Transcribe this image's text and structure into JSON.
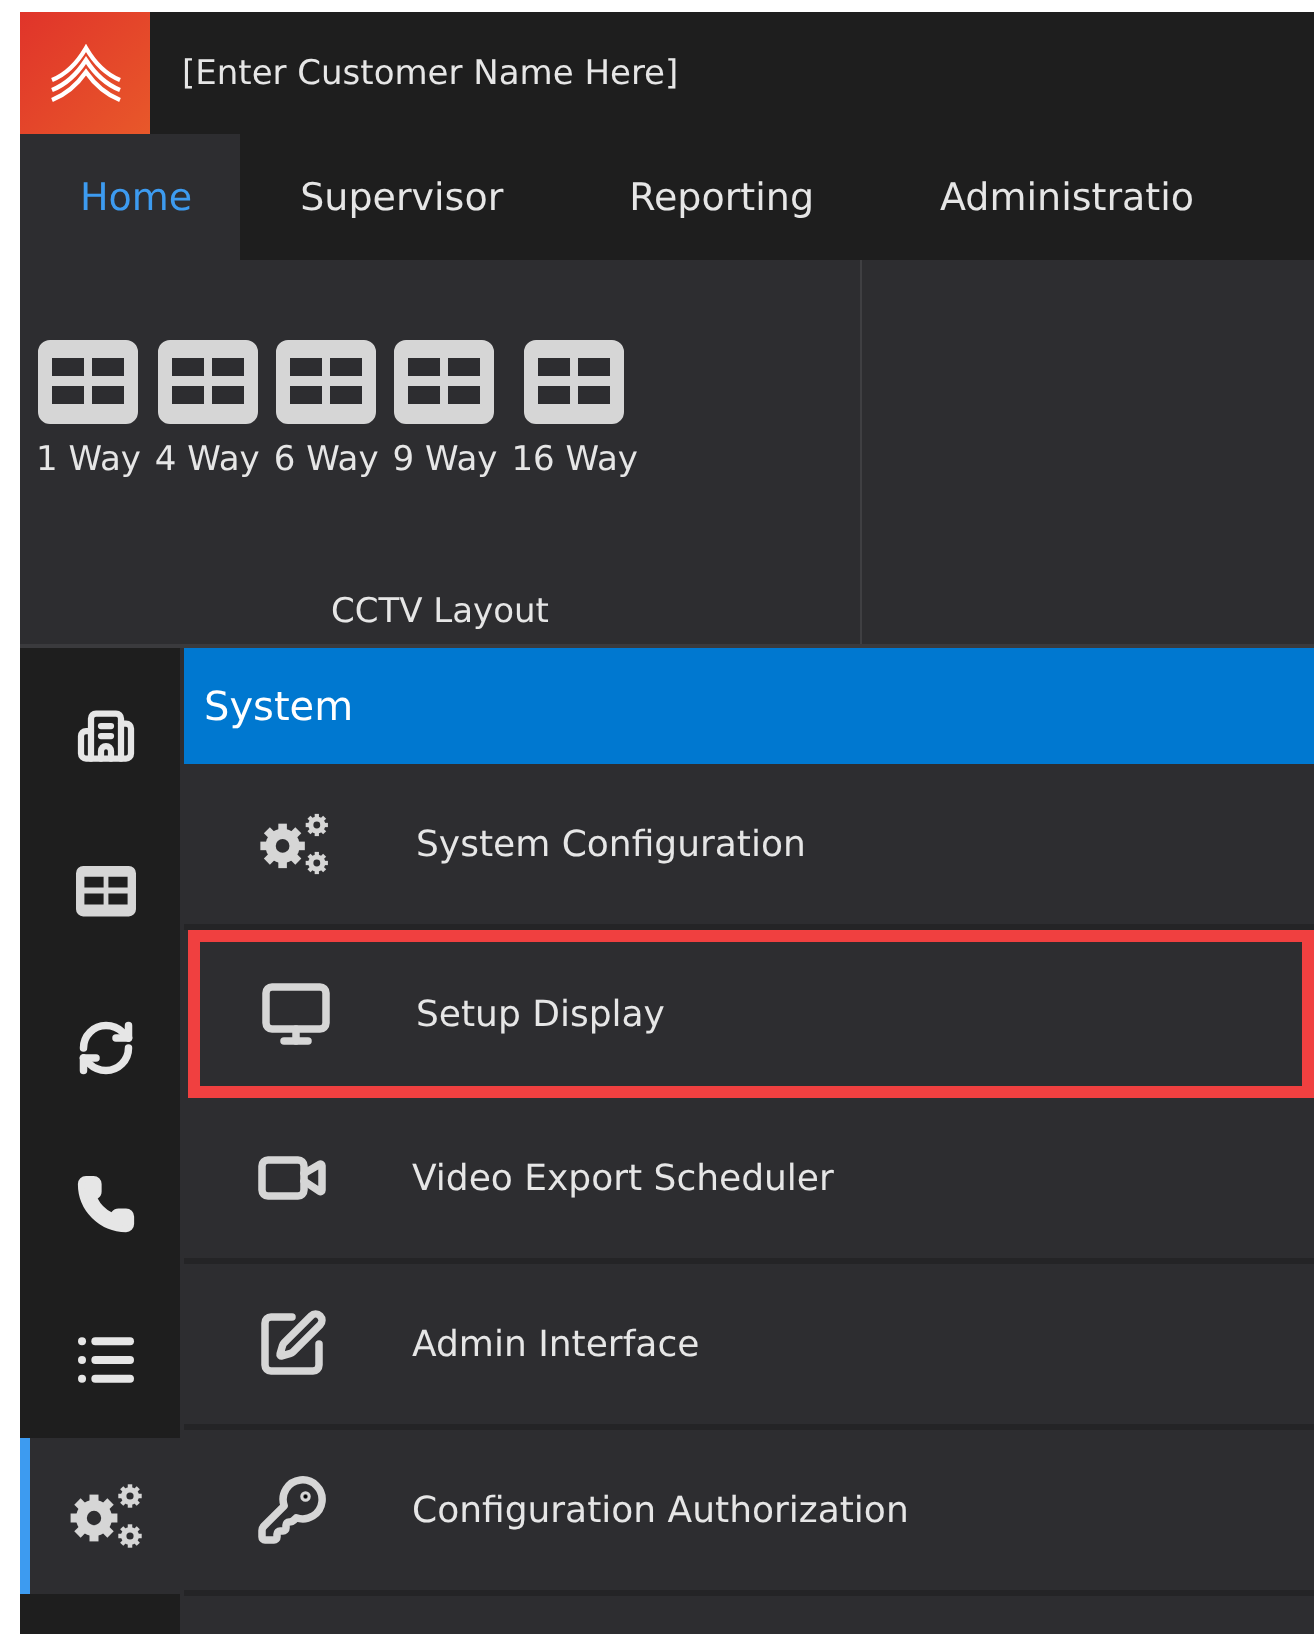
{
  "window": {
    "title": "[Enter Customer Name Here]"
  },
  "tabs": [
    {
      "label": "Home",
      "selected": true
    },
    {
      "label": "Supervisor",
      "selected": false
    },
    {
      "label": "Reporting",
      "selected": false
    },
    {
      "label": "Administratio",
      "selected": false
    }
  ],
  "ribbon": {
    "group_label": "CCTV Layout",
    "buttons": [
      "1 Way",
      "4 Way",
      "6 Way",
      "9 Way",
      "16 Way"
    ]
  },
  "sidebar": {
    "items": [
      {
        "kind": "building",
        "selected": false
      },
      {
        "kind": "grid",
        "selected": false
      },
      {
        "kind": "refresh",
        "selected": false
      },
      {
        "kind": "phone",
        "selected": false
      },
      {
        "kind": "list",
        "selected": false
      },
      {
        "kind": "gears",
        "selected": true
      }
    ]
  },
  "panel": {
    "header": "System",
    "items": [
      {
        "kind": "gears",
        "label": "System Configuration",
        "highlighted": false
      },
      {
        "kind": "monitor",
        "label": "Setup Display",
        "highlighted": true
      },
      {
        "kind": "camera",
        "label": "Video Export Scheduler",
        "highlighted": false
      },
      {
        "kind": "edit",
        "label": "Admin Interface",
        "highlighted": false
      },
      {
        "kind": "key",
        "label": "Configuration Authorization",
        "highlighted": false
      }
    ]
  }
}
